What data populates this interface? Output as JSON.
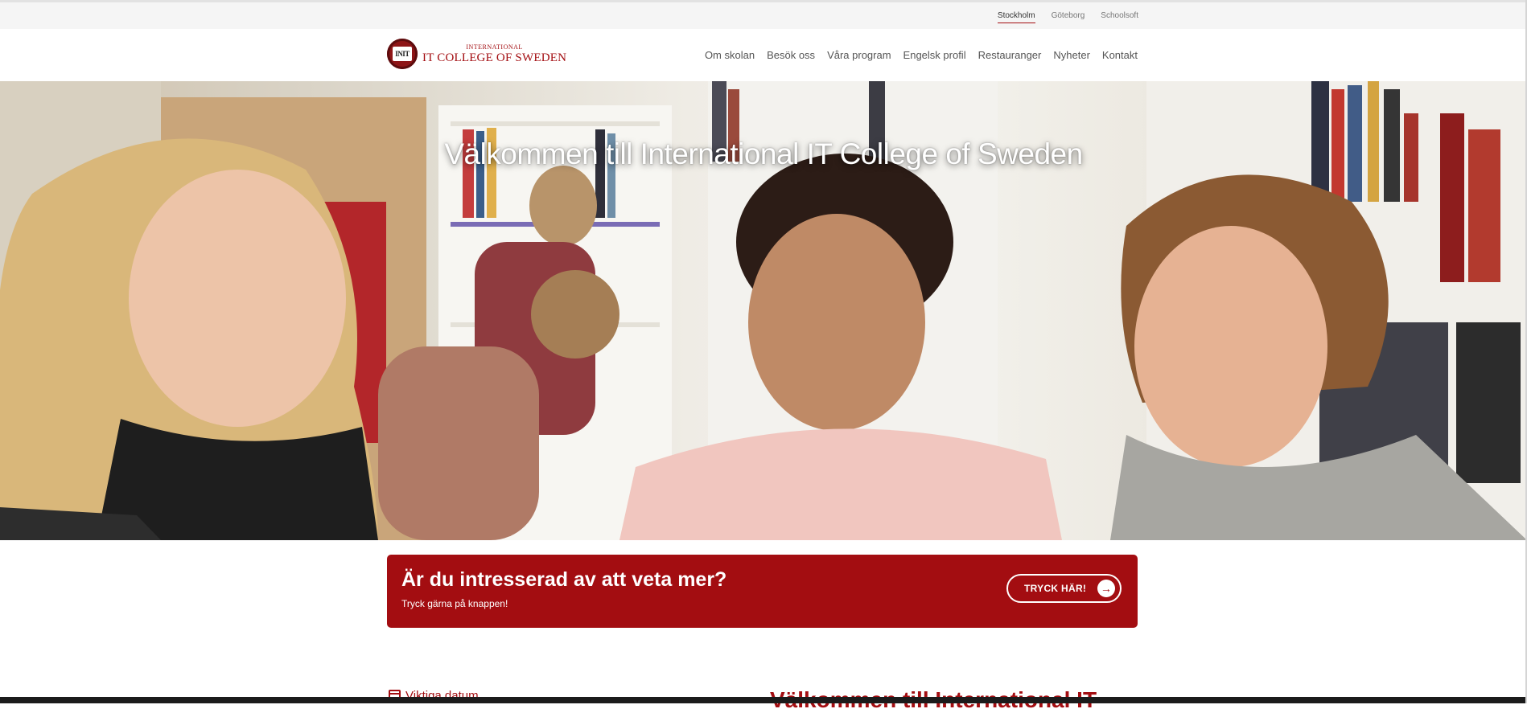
{
  "topbar": {
    "cities": [
      {
        "label": "Stockholm",
        "active": true
      },
      {
        "label": "Göteborg",
        "active": false
      },
      {
        "label": "Schoolsoft",
        "active": false
      }
    ]
  },
  "logo": {
    "emblem_text": "INIT",
    "small_text": "INTERNATIONAL",
    "big_text": "IT COLLEGE OF SWEDEN"
  },
  "nav": {
    "items": [
      "Om skolan",
      "Besök oss",
      "Våra program",
      "Engelsk profil",
      "Restauranger",
      "Nyheter",
      "Kontakt"
    ]
  },
  "hero": {
    "title": "Välkommen till International IT College of Sweden"
  },
  "cta": {
    "heading": "Är du intresserad av att veta mer?",
    "subtext": "Tryck gärna på knappen!",
    "button_label": "TRYCK HÄR!",
    "arrow": "→"
  },
  "below": {
    "left_heading": "Viktiga datum",
    "right_heading": "Välkommen till International IT"
  },
  "colors": {
    "brand": "#a30d11",
    "topbar_bg": "#f5f5f5"
  },
  "icons": {
    "calendar": "calendar-icon",
    "arrow": "arrow-right-icon"
  }
}
